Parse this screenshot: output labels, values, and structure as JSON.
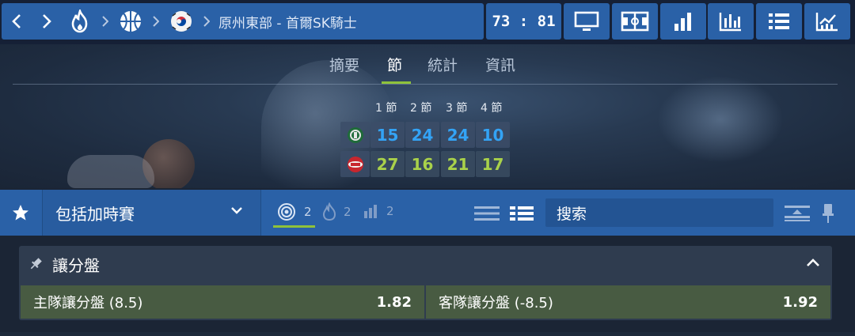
{
  "header": {
    "title": "原州東部 - 首爾SK騎士",
    "score": "73 : 81",
    "icons": [
      "chevron-left-icon",
      "chevron-right-icon",
      "fire-icon",
      "basketball-icon",
      "korea-flag-icon",
      "tv-icon",
      "court-icon",
      "stats-bars-icon",
      "chart-icon",
      "list-icon",
      "trend-icon"
    ]
  },
  "tabs": [
    "摘要",
    "節",
    "統計",
    "資訊"
  ],
  "active_tab": "節",
  "periods": {
    "labels": [
      "1 節",
      "2 節",
      "3 節",
      "4 節"
    ],
    "home": [
      "15",
      "24",
      "24",
      "10"
    ],
    "away": [
      "27",
      "16",
      "21",
      "17"
    ]
  },
  "filter": {
    "dropdown_label": "包括加時賽",
    "count_live": "2",
    "count_hot": "2",
    "count_stats": "2",
    "search_placeholder": "搜索"
  },
  "market": {
    "title": "讓分盤",
    "home_label": "主隊讓分盤 (8.5)",
    "home_price": "1.82",
    "away_label": "客隊讓分盤 (-8.5)",
    "away_price": "1.92"
  },
  "colors": {
    "accent_blue": "#2a61a7",
    "home_color": "#33a3f5",
    "away_color": "#a9d14a",
    "active_underline": "#8fc23a",
    "odd_bg": "#485b42"
  }
}
